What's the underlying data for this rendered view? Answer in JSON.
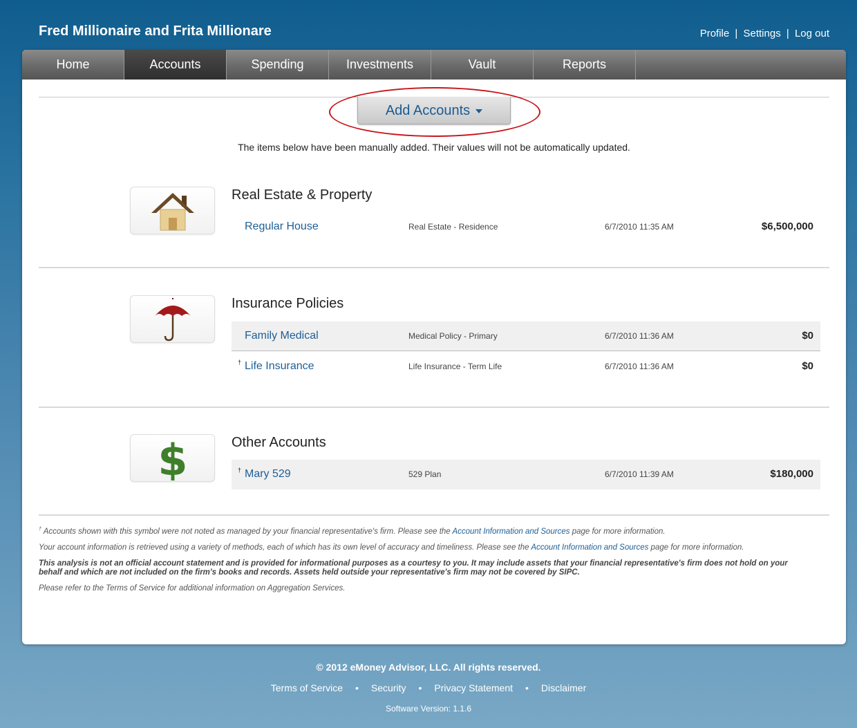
{
  "header": {
    "title": "Fred Millionaire and Frita Millionare",
    "links": [
      "Profile",
      "Settings",
      "Log out"
    ],
    "separator": "|"
  },
  "nav": {
    "tabs": [
      {
        "label": "Home",
        "active": false
      },
      {
        "label": "Accounts",
        "active": true
      },
      {
        "label": "Spending",
        "active": false
      },
      {
        "label": "Investments",
        "active": false
      },
      {
        "label": "Vault",
        "active": false
      },
      {
        "label": "Reports",
        "active": false
      }
    ]
  },
  "add_accounts": {
    "label": "Add Accounts"
  },
  "manual_note": "The items below have been manually added. Their values will not be automatically updated.",
  "sections": [
    {
      "title": "Real Estate & Property",
      "icon": "house-icon",
      "rows": [
        {
          "dagger": "",
          "name": "Regular House",
          "type": "Real Estate - Residence",
          "date": "6/7/2010 11:35 AM",
          "value": "$6,500,000"
        }
      ]
    },
    {
      "title": "Insurance Policies",
      "icon": "umbrella-icon",
      "rows": [
        {
          "dagger": "",
          "name": "Family Medical",
          "type": "Medical Policy - Primary",
          "date": "6/7/2010 11:36 AM",
          "value": "$0"
        },
        {
          "dagger": "†",
          "name": "Life Insurance",
          "type": "Life Insurance - Term Life",
          "date": "6/7/2010 11:36 AM",
          "value": "$0"
        }
      ]
    },
    {
      "title": "Other Accounts",
      "icon": "dollar-icon",
      "rows": [
        {
          "dagger": "†",
          "name": "Mary 529",
          "type": "529 Plan",
          "date": "6/7/2010 11:39 AM",
          "value": "$180,000"
        }
      ]
    }
  ],
  "footnotes": {
    "dagger": "†",
    "note1_pre": "Accounts shown with this symbol were not noted as managed by your financial representative's firm. Please see the ",
    "note1_link": "Account Information and Sources",
    "note1_post": " page for more information.",
    "note2_pre": "Your account information is retrieved using a variety of methods, each of which has its own level of accuracy and timeliness. Please see the ",
    "note2_link": "Account Information and Sources",
    "note2_post": " page for more information.",
    "note3": "This analysis is not an official account statement and is provided for informational purposes as a courtesy to you. It may include assets that your financial representative's firm does not hold on your behalf and which are not included on the firm's books and records. Assets held outside your representative's firm may not be covered by SIPC.",
    "note4": "Please refer to the Terms of Service for additional information on Aggregation Services."
  },
  "footer": {
    "copyright": "© 2012 eMoney Advisor, LLC. All rights reserved.",
    "links": [
      "Terms of Service",
      "Security",
      "Privacy Statement",
      "Disclaimer"
    ],
    "dot": "•",
    "version": "Software Version: 1.1.6"
  },
  "colors": {
    "link": "#1e5e95",
    "highlight_ellipse": "#c8151b",
    "house_roof": "#6b4a25",
    "umbrella": "#a3191c",
    "dollar": "#3f7f2c"
  }
}
